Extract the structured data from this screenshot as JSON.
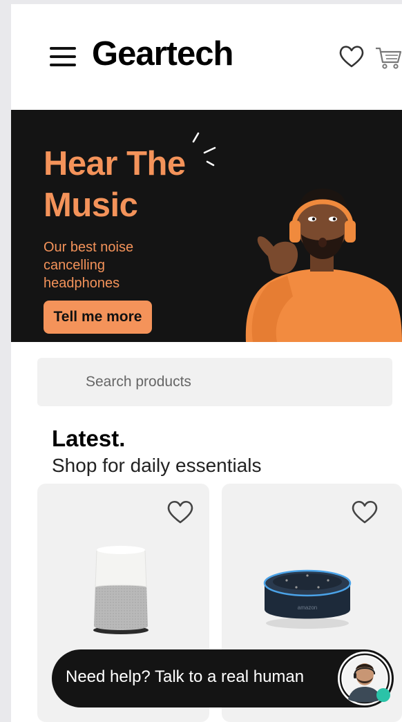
{
  "header": {
    "logo": "Geartech",
    "menu_icon": "hamburger-menu-icon",
    "wishlist_icon": "heart-icon",
    "cart_icon": "shopping-cart-icon"
  },
  "banner": {
    "title_line1": "Hear The",
    "title_line2": "Music",
    "subtitle": "Our best noise cancelling headphones",
    "cta_label": "Tell me more",
    "accent_color": "#f4935a",
    "background_color": "#141414"
  },
  "search": {
    "placeholder": "Search products",
    "value": ""
  },
  "latest": {
    "title": "Latest.",
    "subtitle": "Shop for daily essentials",
    "products": [
      {
        "image": "smart-speaker-white",
        "favorite_icon": "heart-icon"
      },
      {
        "image": "smart-speaker-puck-amazon",
        "favorite_icon": "heart-icon",
        "brand_text": "amazon"
      }
    ]
  },
  "help": {
    "label": "Need help? Talk to a real human",
    "status_color": "#2bc3a8"
  }
}
